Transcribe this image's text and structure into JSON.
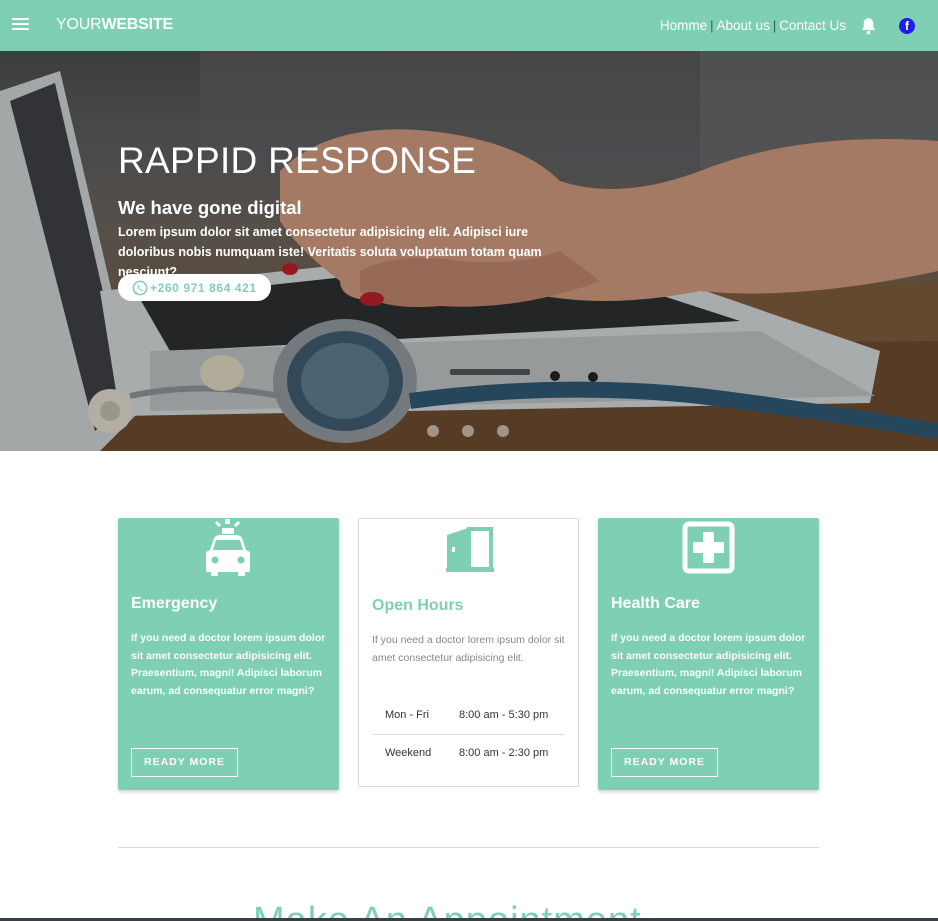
{
  "navbar": {
    "brand_light": "YOUR",
    "brand_bold": "WEBSITE",
    "links": [
      "Homme",
      "About us",
      "Contact Us"
    ],
    "separator": "|",
    "icons": [
      "menu-icon",
      "bell-icon",
      "facebook-icon"
    ],
    "facebook_glyph": "f"
  },
  "hero": {
    "title": "RAPPID RESPONSE",
    "subtitle": "We have gone digital",
    "text": "Lorem ipsum dolor sit amet consectetur adipisicing elit. Adipisci iure doloribus nobis numquam iste! Veritatis soluta voluptatum totam quam nesciunt?",
    "phone": "+260 971 864 421",
    "slide_count": 3
  },
  "cards": [
    {
      "icon": "ambulance-icon",
      "title": "Emergency",
      "text": "If you need a doctor lorem ipsum dolor sit amet consectetur adipisicing elit. Praesentium, magni! Adipisci laborum earum, ad consequatur error magni?",
      "button": "READY MORE"
    },
    {
      "icon": "door-icon",
      "title": "Open Hours",
      "text": "If you need a doctor lorem ipsum dolor sit amet consectetur adipisicing elit.",
      "hours": [
        {
          "day": "Mon - Fri",
          "time": "8:00 am - 5:30 pm"
        },
        {
          "day": "Weekend",
          "time": "8:00 am - 2:30 pm"
        }
      ]
    },
    {
      "icon": "hospital-cross-icon",
      "title": "Health Care",
      "text": "If you need a doctor lorem ipsum dolor sit amet consectetur adipisicing elit. Praesentium, magni! Adipisci laborum earum, ad consequatur error magni?",
      "button": "READY MORE"
    }
  ],
  "next_section": {
    "heading": "Make An Appointment"
  },
  "colors": {
    "accent": "#7ecfb3",
    "facebook": "#1f1ee8"
  }
}
